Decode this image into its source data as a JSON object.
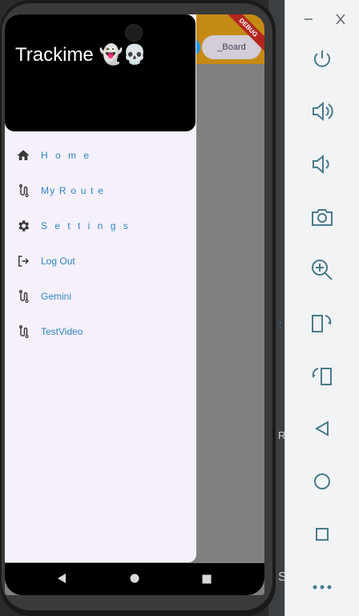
{
  "app": {
    "drawer_title": "Trackime 👻💀",
    "board_button": "_Board",
    "debug_banner": "DEBUG"
  },
  "drawer": {
    "items": [
      {
        "label": "H o m e",
        "icon": "home-icon"
      },
      {
        "label": "My R o u t e",
        "icon": "route-icon"
      },
      {
        "label": "S e t t i n g s",
        "icon": "gear-icon"
      },
      {
        "label": "Log Out",
        "icon": "logout-icon"
      },
      {
        "label": "Gemini",
        "icon": "route-icon"
      },
      {
        "label": "TestVideo",
        "icon": "route-icon"
      }
    ]
  },
  "emulator": {
    "buttons": [
      "power-icon",
      "volume-up-icon",
      "volume-down-icon",
      "camera-icon",
      "zoom-in-icon",
      "rotate-left-icon",
      "rotate-right-icon",
      "back-icon",
      "home-icon",
      "overview-icon",
      "more-icon"
    ]
  },
  "background_text": {
    "a": "R",
    "b": "S"
  },
  "colors": {
    "appbar": "#c58a14",
    "drawer_bg": "#f5f0f9",
    "link": "#2e86c1"
  }
}
